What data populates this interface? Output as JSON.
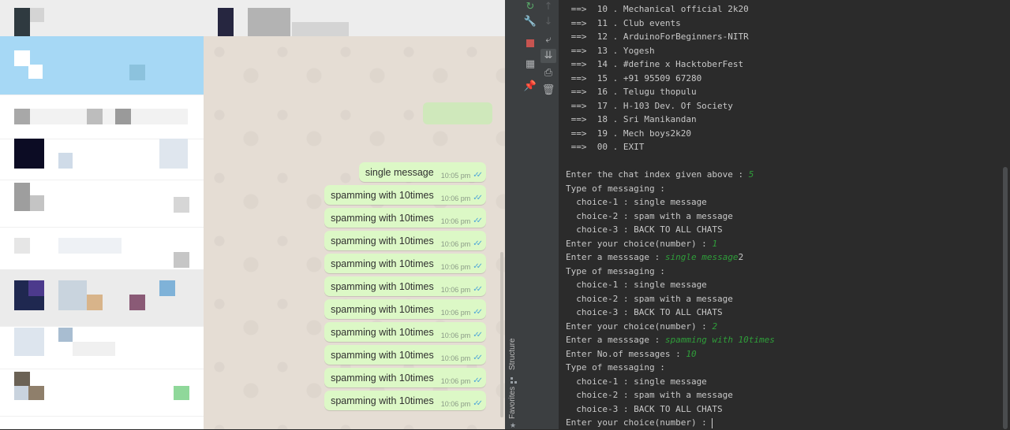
{
  "messages": [
    {
      "text": "single message",
      "time": "10:05 pm"
    },
    {
      "text": "spamming with 10times",
      "time": "10:06 pm"
    },
    {
      "text": "spamming with 10times",
      "time": "10:06 pm"
    },
    {
      "text": "spamming with 10times",
      "time": "10:06 pm"
    },
    {
      "text": "spamming with 10times",
      "time": "10:06 pm"
    },
    {
      "text": "spamming with 10times",
      "time": "10:06 pm"
    },
    {
      "text": "spamming with 10times",
      "time": "10:06 pm"
    },
    {
      "text": "spamming with 10times",
      "time": "10:06 pm"
    },
    {
      "text": "spamming with 10times",
      "time": "10:06 pm"
    },
    {
      "text": "spamming with 10times",
      "time": "10:06 pm"
    },
    {
      "text": "spamming with 10times",
      "time": "10:06 pm"
    }
  ],
  "ide": {
    "tools": [
      "rerun-icon",
      "up-arrow-icon",
      "wrench-icon",
      "down-arrow-icon",
      "stop-icon",
      "soft-wrap-icon",
      "layout-icon",
      "scroll-to-end-icon",
      "print-icon",
      "pin-icon",
      "trash-icon"
    ],
    "structure_label": "Structure",
    "favorites_label": "Favorites"
  },
  "console": {
    "lines": [
      {
        "pre": " ==>  10 . Mechanical official 2k20",
        "in": "",
        "post": ""
      },
      {
        "pre": " ==>  11 . Club events",
        "in": "",
        "post": ""
      },
      {
        "pre": " ==>  12 . ArduinoForBeginners-NITR",
        "in": "",
        "post": ""
      },
      {
        "pre": " ==>  13 . Yogesh",
        "in": "",
        "post": ""
      },
      {
        "pre": " ==>  14 . #define x HacktoberFest",
        "in": "",
        "post": ""
      },
      {
        "pre": " ==>  15 . +91 95509 67280",
        "in": "",
        "post": ""
      },
      {
        "pre": " ==>  16 . Telugu thopulu",
        "in": "",
        "post": ""
      },
      {
        "pre": " ==>  17 . H-103 Dev. Of Society",
        "in": "",
        "post": ""
      },
      {
        "pre": " ==>  18 . Sri Manikandan",
        "in": "",
        "post": ""
      },
      {
        "pre": " ==>  19 . Mech boys2k20",
        "in": "",
        "post": ""
      },
      {
        "pre": " ==>  00 . EXIT",
        "in": "",
        "post": ""
      },
      {
        "pre": "",
        "in": "",
        "post": ""
      },
      {
        "pre": "Enter the chat index given above : ",
        "in": "5",
        "post": ""
      },
      {
        "pre": "Type of messaging :",
        "in": "",
        "post": ""
      },
      {
        "pre": "  choice-1 : single message",
        "in": "",
        "post": ""
      },
      {
        "pre": "  choice-2 : spam with a message",
        "in": "",
        "post": ""
      },
      {
        "pre": "  choice-3 : BACK TO ALL CHATS",
        "in": "",
        "post": ""
      },
      {
        "pre": "Enter your choice(number) : ",
        "in": "1",
        "post": ""
      },
      {
        "pre": "Enter a messsage : ",
        "in": "single message",
        "post": "2"
      },
      {
        "pre": "Type of messaging :",
        "in": "",
        "post": ""
      },
      {
        "pre": "  choice-1 : single message",
        "in": "",
        "post": ""
      },
      {
        "pre": "  choice-2 : spam with a message",
        "in": "",
        "post": ""
      },
      {
        "pre": "  choice-3 : BACK TO ALL CHATS",
        "in": "",
        "post": ""
      },
      {
        "pre": "Enter your choice(number) : ",
        "in": "2",
        "post": ""
      },
      {
        "pre": "Enter a messsage : ",
        "in": "spamming with 10times",
        "post": ""
      },
      {
        "pre": "Enter No.of messages : ",
        "in": "10",
        "post": ""
      },
      {
        "pre": "Type of messaging :",
        "in": "",
        "post": ""
      },
      {
        "pre": "  choice-1 : single message",
        "in": "",
        "post": ""
      },
      {
        "pre": "  choice-2 : spam with a message",
        "in": "",
        "post": ""
      },
      {
        "pre": "  choice-3 : BACK TO ALL CHATS",
        "in": "",
        "post": ""
      },
      {
        "pre": "Enter your choice(number) : ",
        "in": "",
        "post": ""
      }
    ]
  }
}
